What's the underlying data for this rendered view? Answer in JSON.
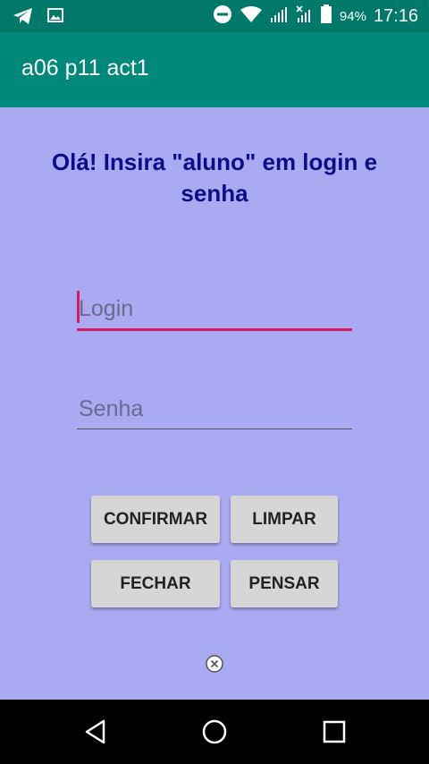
{
  "status_bar": {
    "battery_percent_label": "94%",
    "time": "17:16",
    "icons": [
      "telegram-icon",
      "image-icon",
      "dnd-icon",
      "wifi-icon",
      "signal-icon",
      "signal-x-icon",
      "battery-icon"
    ]
  },
  "app_bar": {
    "title": "a06 p11 act1"
  },
  "main": {
    "headline": "Olá! Insira \"aluno\" em login e senha",
    "login_placeholder": "Login",
    "senha_placeholder": "Senha",
    "buttons": {
      "confirmar": "CONFIRMAR",
      "limpar": "LIMPAR",
      "fechar": "FECHAR",
      "pensar": "PENSAR"
    }
  },
  "nav_bar": {
    "icons": [
      "back-icon",
      "home-icon",
      "recents-icon"
    ]
  },
  "colors": {
    "status_bar": "#00796b",
    "app_bar": "#00897b",
    "background": "#aaaaf2",
    "headline": "#0d0d8c",
    "accent": "#d81b60"
  }
}
